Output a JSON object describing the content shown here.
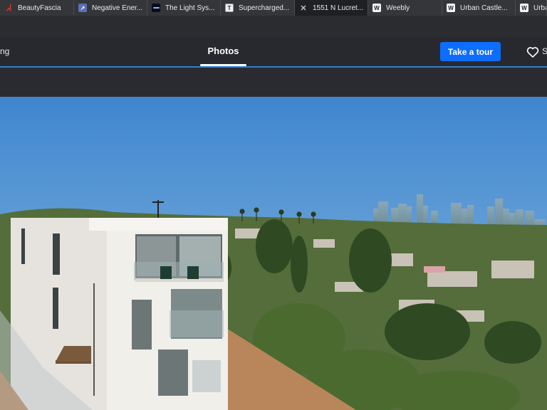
{
  "tabs": [
    {
      "title": "BeautyFascia",
      "icon": "beautyfascia-favicon-icon"
    },
    {
      "title": "Negative Ener...",
      "icon": "negative-energy-favicon-icon"
    },
    {
      "title": "The Light Sys...",
      "icon": "light-system-favicon-icon"
    },
    {
      "title": "Supercharged...",
      "icon": "t-favicon-icon"
    },
    {
      "title": "1551 N Lucret...",
      "icon": "close-tab-icon",
      "active": true
    },
    {
      "title": "Weebly",
      "icon": "weebly-favicon-icon"
    },
    {
      "title": "Urban Castle...",
      "icon": "weebly-favicon-icon"
    },
    {
      "title": "Urba",
      "icon": "weebly-favicon-icon"
    }
  ],
  "nav": {
    "left_item": "ng",
    "active_tab": "Photos",
    "tour_button": "Take a tour",
    "save_partial": "S"
  },
  "colors": {
    "accent": "#0d6efd",
    "header_bg": "#27292e",
    "rule": "#2f7fd6"
  },
  "photo": {
    "alt": "1551 N Lucretia home exterior with downtown Los Angeles skyline"
  }
}
